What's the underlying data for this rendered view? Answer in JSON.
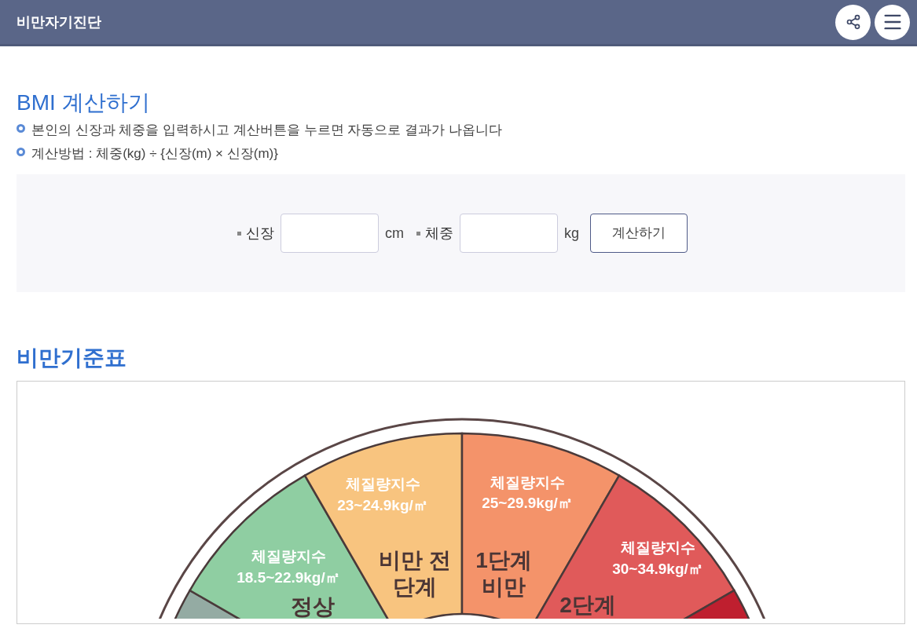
{
  "header": {
    "title": "비만자기진단"
  },
  "calculator": {
    "title": "BMI 계산하기",
    "notes": [
      "본인의 신장과 체중을 입력하시고 계산버튼을 누르면 자동으로 결과가 나옵니다",
      "계산방법 : 체중(kg) ÷ {신장(m) × 신장(m)}"
    ],
    "fields": [
      {
        "label": "신장",
        "unit": "cm"
      },
      {
        "label": "체중",
        "unit": "kg"
      }
    ],
    "button": "계산하기"
  },
  "table": {
    "title": "비만기준표",
    "segments": [
      {
        "color": "#94aba3"
      },
      {
        "color": "#8fcea2",
        "index_label": "체질량지수",
        "range": "18.5~22.9kg/㎡",
        "stage": [
          "정상"
        ]
      },
      {
        "color": "#f8c47f",
        "index_label": "체질량지수",
        "range": "23~24.9kg/㎡",
        "stage": [
          "비만 전",
          "단계"
        ]
      },
      {
        "color": "#f4936a",
        "index_label": "체질량지수",
        "range": "25~29.9kg/㎡",
        "stage": [
          "1단계",
          "비만"
        ]
      },
      {
        "color": "#e05a5a",
        "index_label": "체질량지수",
        "range": "30~34.9kg/㎡",
        "stage": [
          "2단계"
        ]
      },
      {
        "color": "#bf1f2f"
      }
    ]
  }
}
